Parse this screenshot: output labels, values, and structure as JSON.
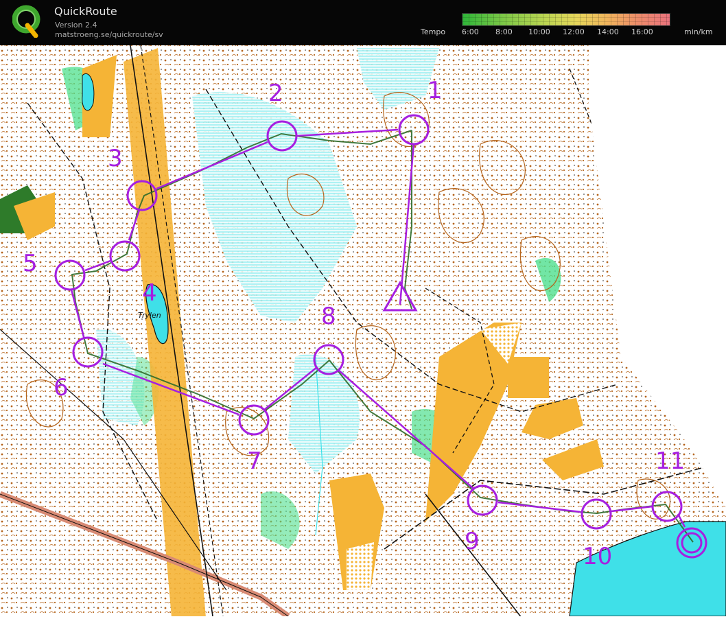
{
  "header": {
    "app_name": "QuickRoute",
    "version": "Version 2.4",
    "url": "matstroeng.se/quickroute/sv",
    "logo_letter": "Q",
    "logo_colors": [
      "#3fa72e",
      "#f4b400"
    ],
    "tempo": {
      "label": "Tempo",
      "unit": "min/km",
      "ticks": [
        "6:00",
        "8:00",
        "10:00",
        "12:00",
        "14:00",
        "16:00"
      ]
    }
  },
  "map": {
    "lake_label": "Trylen",
    "controls": [
      {
        "label": "1"
      },
      {
        "label": "2"
      },
      {
        "label": "3"
      },
      {
        "label": "4"
      },
      {
        "label": "5"
      },
      {
        "label": "6"
      },
      {
        "label": "7"
      },
      {
        "label": "8"
      },
      {
        "label": "9"
      },
      {
        "label": "10"
      },
      {
        "label": "11"
      }
    ],
    "colors": {
      "course": "#a61fe0",
      "water": "#3fe0e8",
      "open_land": "#f5b436",
      "green_vegetation": "#4fe08e",
      "contour": "#b5651d",
      "route": "#2d6b2a"
    }
  }
}
